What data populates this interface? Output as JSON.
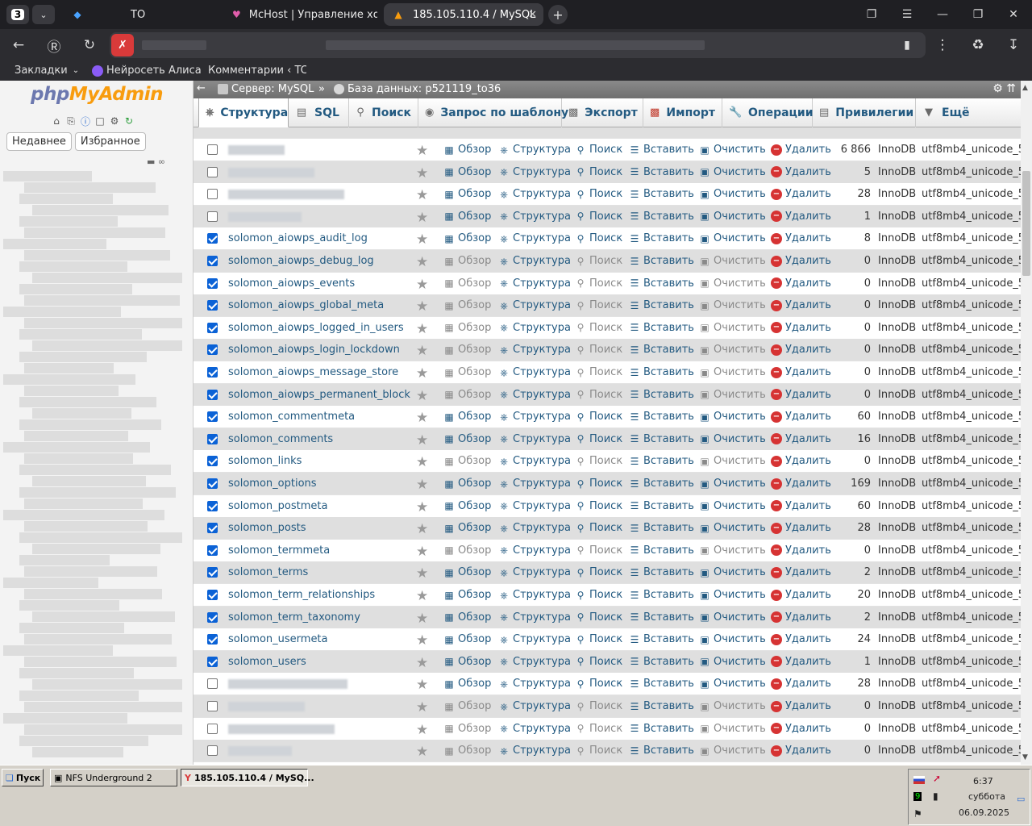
{
  "browser": {
    "tab_count": "3",
    "tabs": [
      {
        "title": "ТО",
        "icon": "shield-icon"
      },
      {
        "title": "McHost | Управление хос",
        "icon": "heart-icon"
      },
      {
        "title": "185.105.110.4 / MySQL",
        "icon": "phpmyadmin-icon"
      }
    ],
    "bookmarks": [
      {
        "label": "Закладки",
        "icon": "chevron-down-icon"
      },
      {
        "label": "Нейросеть Алиса",
        "icon": "alice-icon"
      },
      {
        "label": "Комментарии ‹ TC",
        "icon": "shield-icon"
      }
    ]
  },
  "pma": {
    "logo_php": "php",
    "logo_myadmin": "MyAdmin",
    "recent_label": "Недавнее",
    "favorites_label": "Избранное",
    "breadcrumb_server": "Сервер: MySQL",
    "breadcrumb_sep": "»",
    "breadcrumb_db": "База данных: p521119_to36",
    "menu": [
      {
        "label": "Структура",
        "icon": "structure-icon"
      },
      {
        "label": "SQL",
        "icon": "sql-icon"
      },
      {
        "label": "Поиск",
        "icon": "search-icon"
      },
      {
        "label": "Запрос по шаблону",
        "icon": "query-icon"
      },
      {
        "label": "Экспорт",
        "icon": "export-icon"
      },
      {
        "label": "Импорт",
        "icon": "import-icon"
      },
      {
        "label": "Операции",
        "icon": "wrench-icon"
      },
      {
        "label": "Привилегии",
        "icon": "privileges-icon"
      },
      {
        "label": "Ещё",
        "icon": "chevron-down-icon"
      }
    ],
    "actions": {
      "browse": "Обзор",
      "structure": "Структура",
      "search": "Поиск",
      "insert": "Вставить",
      "empty": "Очистить",
      "drop": "Удалить"
    },
    "rows": [
      {
        "name": "",
        "checked": false,
        "rows": "6 866",
        "engine": "InnoDB",
        "collation": "utf8mb4_unicode_5",
        "blurred": true,
        "dim": false
      },
      {
        "name": "",
        "checked": false,
        "rows": "5",
        "engine": "InnoDB",
        "collation": "utf8mb4_unicode_5",
        "blurred": true,
        "dim": false
      },
      {
        "name": "",
        "checked": false,
        "rows": "28",
        "engine": "InnoDB",
        "collation": "utf8mb4_unicode_5",
        "blurred": true,
        "dim": false
      },
      {
        "name": "",
        "checked": false,
        "rows": "1",
        "engine": "InnoDB",
        "collation": "utf8mb4_unicode_5",
        "blurred": true,
        "dim": false
      },
      {
        "name": "solomon_aiowps_audit_log",
        "checked": true,
        "rows": "8",
        "engine": "InnoDB",
        "collation": "utf8mb4_unicode_5",
        "blurred": false,
        "dim": false
      },
      {
        "name": "solomon_aiowps_debug_log",
        "checked": true,
        "rows": "0",
        "engine": "InnoDB",
        "collation": "utf8mb4_unicode_5",
        "blurred": false,
        "dim": true
      },
      {
        "name": "solomon_aiowps_events",
        "checked": true,
        "rows": "0",
        "engine": "InnoDB",
        "collation": "utf8mb4_unicode_5",
        "blurred": false,
        "dim": true
      },
      {
        "name": "solomon_aiowps_global_meta",
        "checked": true,
        "rows": "0",
        "engine": "InnoDB",
        "collation": "utf8mb4_unicode_5",
        "blurred": false,
        "dim": true
      },
      {
        "name": "solomon_aiowps_logged_in_users",
        "checked": true,
        "rows": "0",
        "engine": "InnoDB",
        "collation": "utf8mb4_unicode_5",
        "blurred": false,
        "dim": true
      },
      {
        "name": "solomon_aiowps_login_lockdown",
        "checked": true,
        "rows": "0",
        "engine": "InnoDB",
        "collation": "utf8mb4_unicode_5",
        "blurred": false,
        "dim": true
      },
      {
        "name": "solomon_aiowps_message_store",
        "checked": true,
        "rows": "0",
        "engine": "InnoDB",
        "collation": "utf8mb4_unicode_5",
        "blurred": false,
        "dim": true
      },
      {
        "name": "solomon_aiowps_permanent_block",
        "checked": true,
        "rows": "0",
        "engine": "InnoDB",
        "collation": "utf8mb4_unicode_5",
        "blurred": false,
        "dim": true
      },
      {
        "name": "solomon_commentmeta",
        "checked": true,
        "rows": "60",
        "engine": "InnoDB",
        "collation": "utf8mb4_unicode_5",
        "blurred": false,
        "dim": false
      },
      {
        "name": "solomon_comments",
        "checked": true,
        "rows": "16",
        "engine": "InnoDB",
        "collation": "utf8mb4_unicode_5",
        "blurred": false,
        "dim": false
      },
      {
        "name": "solomon_links",
        "checked": true,
        "rows": "0",
        "engine": "InnoDB",
        "collation": "utf8mb4_unicode_5",
        "blurred": false,
        "dim": true
      },
      {
        "name": "solomon_options",
        "checked": true,
        "rows": "169",
        "engine": "InnoDB",
        "collation": "utf8mb4_unicode_5",
        "blurred": false,
        "dim": false
      },
      {
        "name": "solomon_postmeta",
        "checked": true,
        "rows": "60",
        "engine": "InnoDB",
        "collation": "utf8mb4_unicode_5",
        "blurred": false,
        "dim": false
      },
      {
        "name": "solomon_posts",
        "checked": true,
        "rows": "28",
        "engine": "InnoDB",
        "collation": "utf8mb4_unicode_5",
        "blurred": false,
        "dim": false
      },
      {
        "name": "solomon_termmeta",
        "checked": true,
        "rows": "0",
        "engine": "InnoDB",
        "collation": "utf8mb4_unicode_5",
        "blurred": false,
        "dim": true
      },
      {
        "name": "solomon_terms",
        "checked": true,
        "rows": "2",
        "engine": "InnoDB",
        "collation": "utf8mb4_unicode_5",
        "blurred": false,
        "dim": false
      },
      {
        "name": "solomon_term_relationships",
        "checked": true,
        "rows": "20",
        "engine": "InnoDB",
        "collation": "utf8mb4_unicode_5",
        "blurred": false,
        "dim": false
      },
      {
        "name": "solomon_term_taxonomy",
        "checked": true,
        "rows": "2",
        "engine": "InnoDB",
        "collation": "utf8mb4_unicode_5",
        "blurred": false,
        "dim": false
      },
      {
        "name": "solomon_usermeta",
        "checked": true,
        "rows": "24",
        "engine": "InnoDB",
        "collation": "utf8mb4_unicode_5",
        "blurred": false,
        "dim": false
      },
      {
        "name": "solomon_users",
        "checked": true,
        "rows": "1",
        "engine": "InnoDB",
        "collation": "utf8mb4_unicode_5",
        "blurred": false,
        "dim": false
      },
      {
        "name": "",
        "checked": false,
        "rows": "28",
        "engine": "InnoDB",
        "collation": "utf8mb4_unicode_5",
        "blurred": true,
        "dim": false
      },
      {
        "name": "",
        "checked": false,
        "rows": "0",
        "engine": "InnoDB",
        "collation": "utf8mb4_unicode_5",
        "blurred": true,
        "dim": true
      },
      {
        "name": "",
        "checked": false,
        "rows": "0",
        "engine": "InnoDB",
        "collation": "utf8mb4_unicode_5",
        "blurred": true,
        "dim": true
      },
      {
        "name": "",
        "checked": false,
        "rows": "0",
        "engine": "InnoDB",
        "collation": "utf8mb4_unicode_5",
        "blurred": true,
        "dim": true
      }
    ]
  },
  "taskbar": {
    "start_label": "Пуск",
    "windows": [
      {
        "label": "NFS Underground 2",
        "active": false
      },
      {
        "label": "185.105.110.4 / MySQ...",
        "active": true
      }
    ],
    "time": "6:37",
    "day": "суббота",
    "date": "06.09.2025"
  },
  "colors": {
    "link": "#235a81",
    "checkbox": "#0b62d6",
    "drop": "#d63333",
    "logo_php": "#6c78af",
    "logo_myadmin": "#f89c0e"
  }
}
